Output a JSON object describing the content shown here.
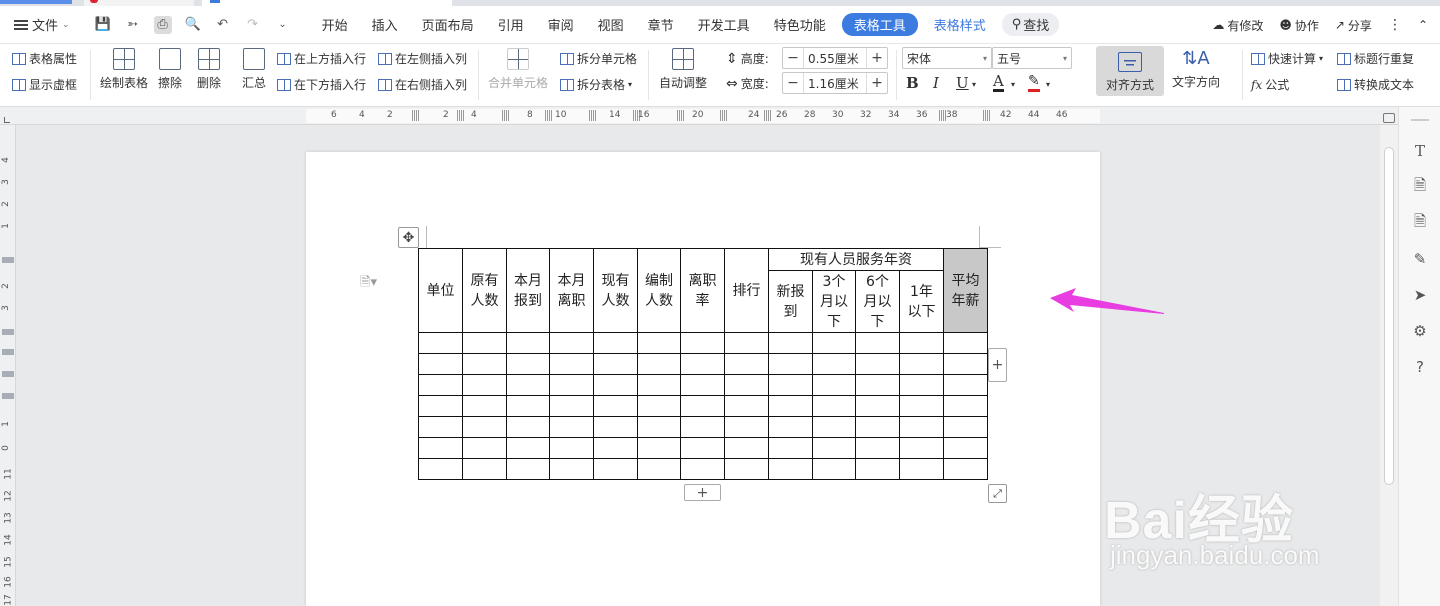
{
  "menu": {
    "file_label": "文件",
    "tabs": [
      "开始",
      "插入",
      "页面布局",
      "引用",
      "审阅",
      "视图",
      "章节",
      "开发工具",
      "特色功能"
    ],
    "active_tab": "表格工具",
    "style_tab": "表格样式",
    "search_label": "查找",
    "right": {
      "modified": "有修改",
      "collab": "协作",
      "share": "分享"
    }
  },
  "ribbon": {
    "table_props": "表格属性",
    "show_gridlines": "显示虚框",
    "draw_table": "绘制表格",
    "erase": "擦除",
    "delete": "删除",
    "summary": "汇总",
    "insert_above": "在上方插入行",
    "insert_below": "在下方插入行",
    "insert_left": "在左侧插入列",
    "insert_right": "在右侧插入列",
    "merge_cells": "合并单元格",
    "split_cells": "拆分单元格",
    "split_table": "拆分表格",
    "auto_fit": "自动调整",
    "height_label": "高度:",
    "height_value": "0.55厘米",
    "width_label": "宽度:",
    "width_value": "1.16厘米",
    "font_name": "宋体",
    "font_size": "五号",
    "bold": "B",
    "italic": "I",
    "underline": "U",
    "font_color": "A",
    "align": "对齐方式",
    "text_direction": "文字方向",
    "quick_calc": "快速计算",
    "formula": "公式",
    "repeat_header": "标题行重复",
    "to_text": "转换成文本"
  },
  "ruler": {
    "numbers": [
      "6",
      "4",
      "2",
      "2",
      "4",
      "8",
      "10",
      "14",
      "16",
      "20",
      "24",
      "26",
      "28",
      "30",
      "32",
      "34",
      "36",
      "38",
      "42",
      "44",
      "46"
    ],
    "vertical_numbers": [
      "4",
      "3",
      "2",
      "1",
      "2",
      "3",
      "1",
      "0",
      "11",
      "12",
      "13",
      "14",
      "15",
      "16",
      "17"
    ]
  },
  "table": {
    "header_top": [
      "单位",
      "原有人数",
      "本月报到",
      "本月离职",
      "现有人数",
      "编制人数",
      "离职率",
      "排行",
      "现有人员服务年资",
      "平均年薪"
    ],
    "header_sub": [
      "新报到",
      "3个月以下",
      "6个月以下",
      "1年以下"
    ],
    "data_rows": 7,
    "columns": 13,
    "highlight_color": "#c8c8c8"
  },
  "annotation": {
    "arrow_color": "#e83de0"
  },
  "watermark": {
    "brand": "Bai经验",
    "url": "jingyan.baidu.com"
  },
  "colors": {
    "accent": "#3c7be0"
  }
}
